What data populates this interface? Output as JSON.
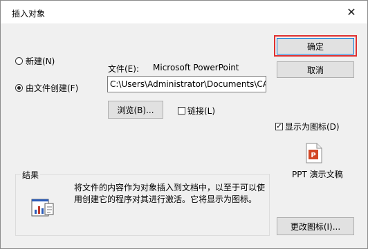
{
  "window": {
    "title": "插入对象",
    "close_glyph": "✕"
  },
  "buttons": {
    "ok": "确定",
    "cancel": "取消",
    "browse": "浏览(B)...",
    "change_icon": "更改图标(I)..."
  },
  "options": {
    "create_new": "新建(N)",
    "create_from_file": "由文件创建(F)",
    "selected": "create_from_file"
  },
  "file": {
    "label": "文件(E):",
    "app_name": "Microsoft PowerPoint",
    "path": "C:\\Users\\Administrator\\Documents\\CA"
  },
  "link": {
    "label": "链接(L)",
    "checked": false
  },
  "display_as_icon": {
    "label": "显示为图标(D)",
    "checked": true
  },
  "icon": {
    "name": "powerpoint-file-icon",
    "caption": "PPT 演示文稿"
  },
  "result": {
    "heading": "结果",
    "text": "将文件的内容作为对象插入到文档中，以至于可以使用创建它的程序对其进行激活。它将显示为图标。"
  },
  "colors": {
    "accent": "#0078d7",
    "highlight": "#e03030",
    "ppt": "#d24726"
  }
}
